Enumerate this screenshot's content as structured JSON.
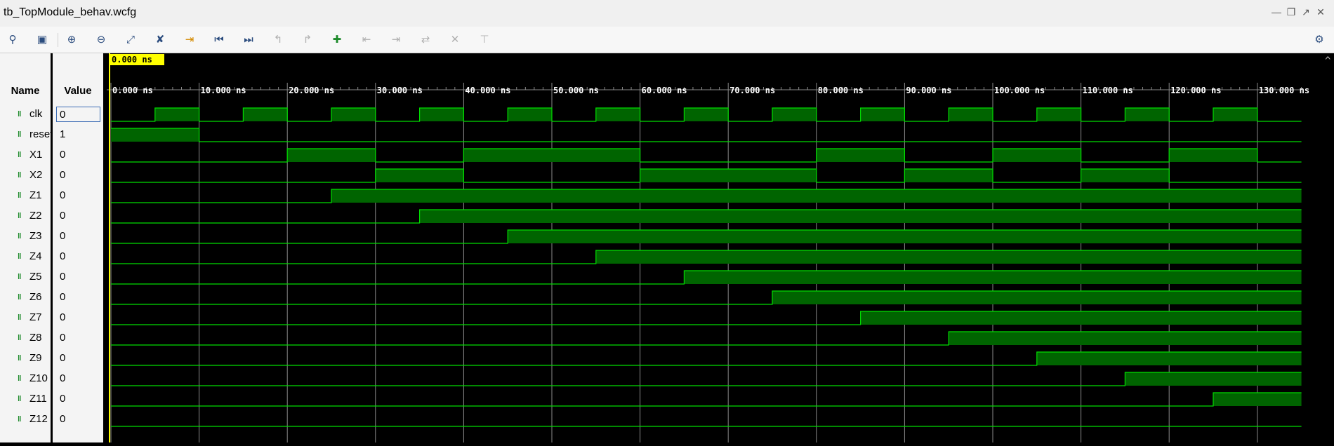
{
  "window": {
    "title": "tb_TopModule_behav.wcfg"
  },
  "toolbar": {
    "buttons": [
      {
        "name": "search-button",
        "icon": "magnifier-icon"
      },
      {
        "name": "save-button",
        "icon": "save-icon"
      },
      {
        "name": "zoom-in-button",
        "icon": "zoom-in-icon"
      },
      {
        "name": "zoom-out-button",
        "icon": "zoom-out-icon"
      },
      {
        "name": "zoom-fit-button",
        "icon": "zoom-fit-icon"
      },
      {
        "name": "zoom-cursor-button",
        "icon": "zoom-cursor-icon"
      },
      {
        "name": "go-to-cursor-button",
        "icon": "cursor-arrow-icon"
      },
      {
        "name": "go-to-time-zero-button",
        "icon": "skip-start-icon"
      },
      {
        "name": "go-to-last-time-button",
        "icon": "skip-end-icon"
      },
      {
        "name": "previous-transition-button",
        "icon": "prev-transition-icon"
      },
      {
        "name": "next-transition-button",
        "icon": "next-transition-icon"
      },
      {
        "name": "add-marker-button",
        "icon": "add-marker-icon"
      },
      {
        "name": "previous-marker-button",
        "icon": "prev-marker-icon"
      },
      {
        "name": "next-marker-button",
        "icon": "next-marker-icon"
      },
      {
        "name": "swap-cursors-button",
        "icon": "swap-cursors-icon"
      },
      {
        "name": "snap-transition-button",
        "icon": "close-x-icon"
      },
      {
        "name": "float-ruler-button",
        "icon": "ruler-icon"
      }
    ],
    "settings_icon": "gear-icon"
  },
  "columns": {
    "name_header": "Name",
    "value_header": "Value"
  },
  "cursor": {
    "label": "0.000 ns",
    "color": "#ffff00"
  },
  "colors": {
    "wave_fill": "#006400",
    "wave_line": "#00dd00",
    "grid": "#8a8a8a",
    "background": "#000000"
  },
  "timeline": {
    "unit": "ns",
    "start": 0,
    "end": 135,
    "tick_labels": [
      "0.000 ns",
      "10.000 ns",
      "20.000 ns",
      "30.000 ns",
      "40.000 ns",
      "50.000 ns",
      "60.000 ns",
      "70.000 ns",
      "80.000 ns",
      "90.000 ns",
      "100.000 ns",
      "110.000 ns",
      "120.000 ns",
      "130.000 ns"
    ],
    "tick_values": [
      0,
      10,
      20,
      30,
      40,
      50,
      60,
      70,
      80,
      90,
      100,
      110,
      120,
      130
    ]
  },
  "signals": [
    {
      "name": "clk",
      "value": "0",
      "selected": true,
      "highs": [
        [
          5,
          10
        ],
        [
          15,
          20
        ],
        [
          25,
          30
        ],
        [
          35,
          40
        ],
        [
          45,
          50
        ],
        [
          55,
          60
        ],
        [
          65,
          70
        ],
        [
          75,
          80
        ],
        [
          85,
          90
        ],
        [
          95,
          100
        ],
        [
          105,
          110
        ],
        [
          115,
          120
        ],
        [
          125,
          130
        ]
      ]
    },
    {
      "name": "reset",
      "value": "1",
      "highs": [
        [
          0,
          10
        ]
      ]
    },
    {
      "name": "X1",
      "value": "0",
      "highs": [
        [
          20,
          30
        ],
        [
          40,
          60
        ],
        [
          80,
          90
        ],
        [
          100,
          110
        ],
        [
          120,
          130
        ]
      ]
    },
    {
      "name": "X2",
      "value": "0",
      "highs": [
        [
          30,
          40
        ],
        [
          60,
          80
        ],
        [
          90,
          100
        ],
        [
          110,
          120
        ]
      ]
    },
    {
      "name": "Z1",
      "value": "0",
      "highs": [
        [
          25,
          135
        ]
      ]
    },
    {
      "name": "Z2",
      "value": "0",
      "highs": [
        [
          35,
          135
        ]
      ]
    },
    {
      "name": "Z3",
      "value": "0",
      "highs": [
        [
          45,
          135
        ]
      ]
    },
    {
      "name": "Z4",
      "value": "0",
      "highs": [
        [
          55,
          135
        ]
      ]
    },
    {
      "name": "Z5",
      "value": "0",
      "highs": [
        [
          65,
          135
        ]
      ]
    },
    {
      "name": "Z6",
      "value": "0",
      "highs": [
        [
          75,
          135
        ]
      ]
    },
    {
      "name": "Z7",
      "value": "0",
      "highs": [
        [
          85,
          135
        ]
      ]
    },
    {
      "name": "Z8",
      "value": "0",
      "highs": [
        [
          95,
          135
        ]
      ]
    },
    {
      "name": "Z9",
      "value": "0",
      "highs": [
        [
          105,
          135
        ]
      ]
    },
    {
      "name": "Z10",
      "value": "0",
      "highs": [
        [
          115,
          135
        ]
      ]
    },
    {
      "name": "Z11",
      "value": "0",
      "highs": [
        [
          125,
          135
        ]
      ]
    },
    {
      "name": "Z12",
      "value": "0",
      "highs": []
    }
  ]
}
